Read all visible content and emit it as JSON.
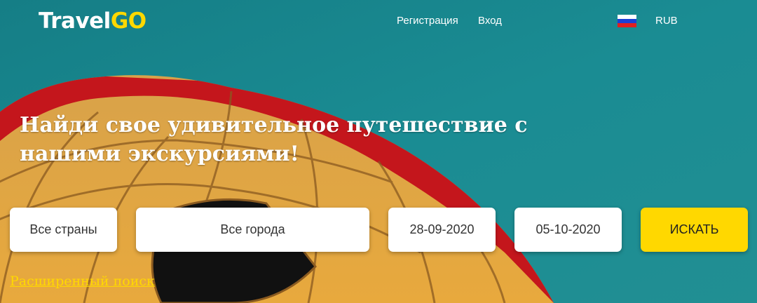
{
  "logo": {
    "part1": "Travel",
    "part2": "GO"
  },
  "header": {
    "register": "Регистрация",
    "login": "Вход",
    "currency": "RUB"
  },
  "colors": {
    "accent": "#ffd800",
    "sky": "#1a8a90",
    "flag": [
      "#ffffff",
      "#1c3fd6",
      "#e02020"
    ]
  },
  "hero": {
    "headline": "Найди свое удивительное путешествие с нашими экскурсиями!"
  },
  "search": {
    "country": "Все страны",
    "city": "Все города",
    "date_from": "28-09-2020",
    "date_to": "05-10-2020",
    "button": "ИСКАТЬ"
  },
  "advanced_search": "Расширенный поиск"
}
